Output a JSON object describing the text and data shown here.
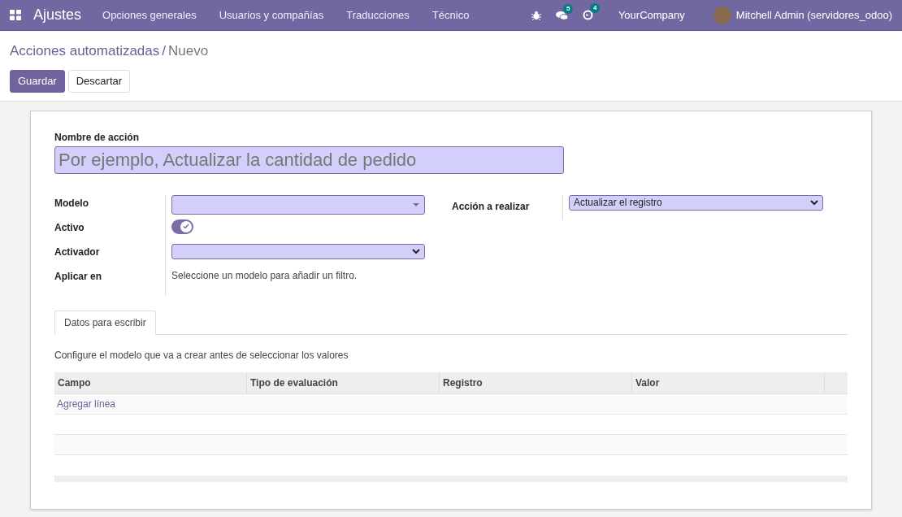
{
  "navbar": {
    "app_name": "Ajustes",
    "menus": [
      "Opciones generales",
      "Usuarios y compañías",
      "Traducciones",
      "Técnico"
    ],
    "systray": [
      {
        "kind": "debug"
      },
      {
        "kind": "messages",
        "count": "5"
      },
      {
        "kind": "activities",
        "count": "4"
      }
    ],
    "company": "YourCompany",
    "user": "Mitchell Admin (servidores_odoo)"
  },
  "breadcrumb": {
    "parent": "Acciones automatizadas",
    "separator": "/",
    "current": "Nuevo"
  },
  "buttons": [
    {
      "label": "Guardar",
      "kind": "primary"
    },
    {
      "label": "Descartar",
      "kind": "secondary"
    }
  ],
  "form": {
    "name_label": "Nombre de acción",
    "name_placeholder": "Por ejemplo, Actualizar la cantidad de pedido",
    "left_fields": [
      {
        "label": "Modelo",
        "kind": "many2one"
      },
      {
        "label": "Activo",
        "kind": "toggle",
        "on": true
      },
      {
        "label": "Activador",
        "kind": "select"
      },
      {
        "label": "Aplicar en",
        "kind": "text",
        "value": "Seleccione un modelo para añadir un filtro."
      }
    ],
    "right_fields": [
      {
        "label": "Acción a realizar",
        "kind": "select",
        "value": "Actualizar el registro"
      }
    ]
  },
  "tabs": [
    {
      "label": "Datos para escribir",
      "selected": true
    }
  ],
  "tab_note": "Configure el modelo que va a crear antes de seleccionar los valores",
  "table": {
    "columns": [
      "Campo",
      "Tipo de evaluación",
      "Registro",
      "Valor"
    ],
    "add_line": "Agregar línea"
  }
}
